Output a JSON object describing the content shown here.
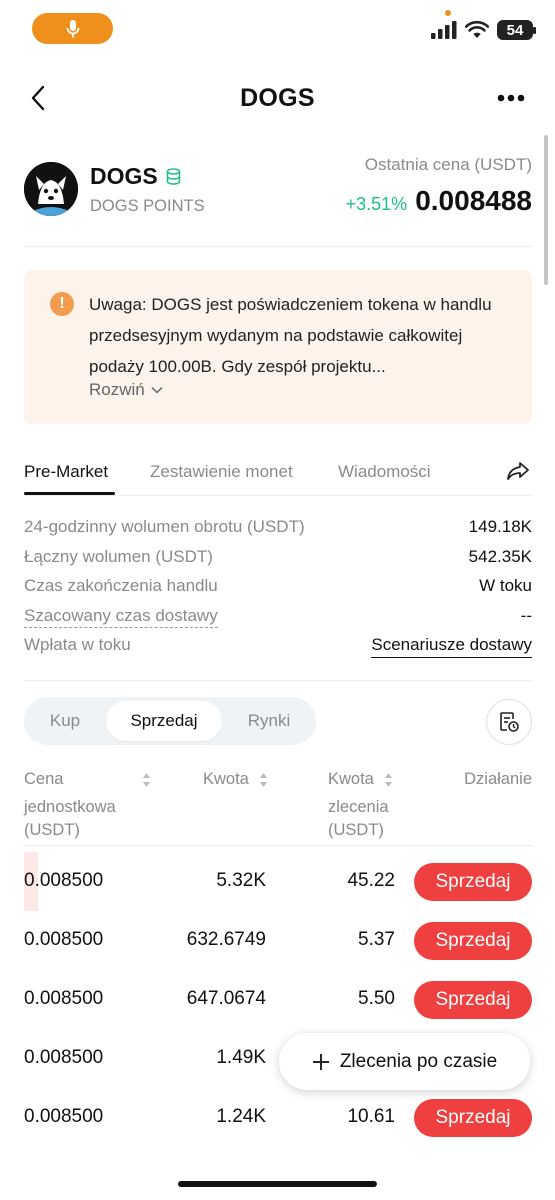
{
  "status_bar": {
    "battery": "54"
  },
  "header": {
    "title": "DOGS"
  },
  "token": {
    "name": "DOGS",
    "subtitle": "DOGS POINTS",
    "last_price_label": "Ostatnia cena (USDT)",
    "change": "+3.51%",
    "price": "0.008488"
  },
  "warning": {
    "text": "Uwaga: DOGS jest poświadczeniem tokena w handlu przedsesyjnym wydanym na podstawie całkowitej podaży 100.00B. Gdy zespół projektu...",
    "expand_label": "Rozwiń"
  },
  "tabs": [
    {
      "label": "Pre-Market"
    },
    {
      "label": "Zestawienie monet"
    },
    {
      "label": "Wiadomości"
    }
  ],
  "stats": [
    {
      "label": "24-godzinny wolumen obrotu (USDT)",
      "value": "149.18K"
    },
    {
      "label": "Łączny wolumen (USDT)",
      "value": "542.35K"
    },
    {
      "label": "Czas zakończenia handlu",
      "value": "W toku"
    },
    {
      "label": "Szacowany czas dostawy",
      "value": "--"
    },
    {
      "label": "Wpłata w toku",
      "value": "Scenariusze dostawy"
    }
  ],
  "segments": [
    {
      "label": "Kup"
    },
    {
      "label": "Sprzedaj"
    },
    {
      "label": "Rynki"
    }
  ],
  "table": {
    "headers": {
      "price": [
        "Cena",
        "jednostkowa",
        "(USDT)"
      ],
      "amount": [
        "Kwota"
      ],
      "order": [
        "Kwota",
        "zlecenia",
        "(USDT)"
      ],
      "action": [
        "Działanie"
      ]
    },
    "rows": [
      {
        "price": "0.008500",
        "amount": "5.32K",
        "order": "45.22",
        "action": "Sprzedaj"
      },
      {
        "price": "0.008500",
        "amount": "632.6749",
        "order": "5.37",
        "action": "Sprzedaj"
      },
      {
        "price": "0.008500",
        "amount": "647.0674",
        "order": "5.50",
        "action": "Sprzedaj"
      },
      {
        "price": "0.008500",
        "amount": "1.49K",
        "order": "",
        "action": ""
      },
      {
        "price": "0.008500",
        "amount": "1.24K",
        "order": "10.61",
        "action": "Sprzedaj"
      }
    ]
  },
  "fab": {
    "label": "Zlecenia po czasie"
  },
  "colors": {
    "accent_orange": "#f0901c",
    "positive": "#1ebc8a",
    "sell_red": "#ef3f3f",
    "warning_bg": "#fdf3ea"
  }
}
